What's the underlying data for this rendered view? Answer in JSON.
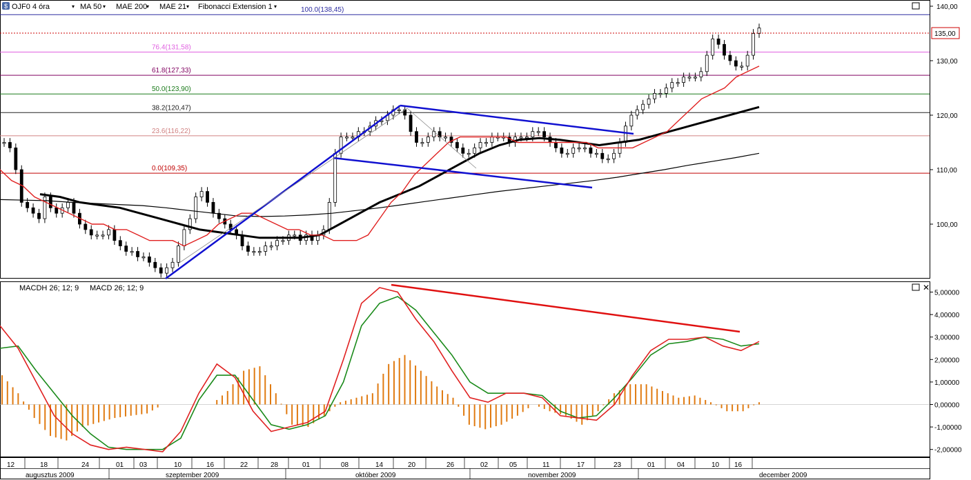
{
  "toolbar": {
    "symbol": "OJF0 4 óra",
    "ma50": "MA 50",
    "mae200": "MAE 200",
    "mae21": "MAE 21",
    "fib": "Fibonacci Extension 1"
  },
  "macd_legend": {
    "macdh": "MACDH 26; 12; 9",
    "macd": "MACD 26; 12; 9"
  },
  "price_axis": {
    "ticks": [
      "140,00",
      "130,00",
      "120,00",
      "110,00",
      "100,00"
    ],
    "current": "135,00"
  },
  "macd_axis": {
    "ticks": [
      "5,00000",
      "4,00000",
      "3,00000",
      "2,00000",
      "1,00000",
      "0,00000",
      "-1,00000",
      "-2,00000"
    ]
  },
  "fib_levels": [
    {
      "label": "100.0(138,45)",
      "value": 138.45,
      "color": "#2a2aa0"
    },
    {
      "label": "76.4(131,58)",
      "value": 131.58,
      "color": "#e060e0"
    },
    {
      "label": "61.8(127,33)",
      "value": 127.33,
      "color": "#800060"
    },
    {
      "label": "50.0(123,90)",
      "value": 123.9,
      "color": "#1a7a1a"
    },
    {
      "label": "38.2(120,47)",
      "value": 120.47,
      "color": "#222222"
    },
    {
      "label": "23.6(116,22)",
      "value": 116.22,
      "color": "#d08080"
    },
    {
      "label": "0.0(109,35)",
      "value": 109.35,
      "color": "#c00000"
    }
  ],
  "x_axis": {
    "day_ticks": [
      "12",
      "18",
      "24",
      "01",
      "03",
      "10",
      "16",
      "22",
      "28",
      "01",
      "08",
      "14",
      "20",
      "26",
      "02",
      "05",
      "11",
      "17",
      "23",
      "01",
      "04",
      "10",
      "16"
    ],
    "month_labels": [
      "augusztus 2009",
      "szeptember 2009",
      "október 2009",
      "november 2009",
      "december 2009"
    ]
  },
  "colors": {
    "mae21": "#e02020",
    "mae200": "#000000",
    "ma50": "#000000",
    "macd": "#1a8a1a",
    "macdh": "#e07a10",
    "channel": "#1010d0",
    "divergence": "#e01010",
    "current": "#cc0000"
  },
  "chart_data": [
    {
      "type": "candlestick",
      "title": "OJF0 4 óra",
      "ylim": [
        91,
        141
      ],
      "current_price": 135.0,
      "series_close": [
        115,
        114,
        110,
        104,
        103,
        102,
        101,
        105,
        103,
        102,
        103,
        104,
        102,
        100,
        99,
        98,
        98,
        98,
        99,
        97,
        96,
        95,
        95,
        94,
        94,
        93,
        92,
        91,
        92,
        93,
        96,
        99,
        101,
        105,
        106,
        104,
        102,
        101,
        100,
        99,
        98,
        96,
        95,
        95,
        95,
        96,
        96,
        97,
        97,
        98,
        98,
        97,
        98,
        97,
        98,
        99,
        104,
        113,
        116,
        116,
        116,
        117,
        117,
        118,
        119,
        119,
        120,
        121,
        121,
        120,
        117,
        115,
        115,
        116,
        117,
        116,
        116,
        115,
        114,
        113,
        113,
        114,
        115,
        115,
        116,
        116,
        116,
        115,
        116,
        116,
        116,
        117,
        117,
        116,
        115,
        114,
        113,
        113,
        114,
        114,
        114,
        113,
        113,
        112,
        112,
        113,
        115,
        118,
        120,
        121,
        122,
        123,
        124,
        124,
        125,
        126,
        126,
        127,
        127,
        127,
        128,
        131,
        134,
        133,
        131,
        130,
        129,
        129,
        131,
        135,
        136
      ],
      "mae21": [
        110,
        108,
        107,
        105,
        104,
        103,
        102,
        101,
        100,
        100,
        99,
        99,
        98,
        97,
        97,
        97,
        96,
        97,
        98,
        100,
        101,
        102,
        102,
        101,
        100,
        99,
        99,
        98,
        98,
        97,
        97,
        97,
        98,
        101,
        104,
        106,
        109,
        111,
        113,
        115,
        116,
        116,
        116,
        116,
        116,
        115,
        115,
        115,
        115,
        115,
        115,
        115,
        114,
        114,
        114,
        114,
        115,
        116,
        117,
        119,
        121,
        123,
        124,
        125,
        127,
        128,
        129
      ],
      "mae200": [
        104.5,
        104.4,
        104.3,
        104.0,
        103.8,
        103.6,
        103.4,
        103.0,
        102.5,
        102.0,
        101.5,
        101.4,
        101.5,
        101.7,
        102.0,
        102.5,
        103.0,
        103.6,
        104.2,
        104.8,
        105.4,
        106.0,
        106.5,
        107.0,
        107.5,
        108.0,
        108.6,
        109.3,
        110.0,
        110.8,
        111.5,
        112.2,
        113.0
      ],
      "ma50": [
        105.5,
        105,
        104,
        103.5,
        103,
        102,
        101,
        100,
        99,
        98.5,
        98,
        97.5,
        97.5,
        97.5,
        98,
        100,
        102,
        104,
        105.5,
        107,
        109,
        111,
        113,
        114.5,
        115.5,
        115.8,
        115.5,
        115,
        114.5,
        115,
        115.5,
        116.5,
        117.5,
        118.5,
        119.5,
        120.5,
        121.5
      ]
    },
    {
      "type": "line",
      "title": "MACD 26; 12; 9",
      "ylim": [
        -2.3,
        5.3
      ],
      "macd": [
        3.5,
        2.5,
        1.0,
        -0.5,
        -1.3,
        -1.8,
        -2.0,
        -1.9,
        -2.0,
        -2.1,
        -1.2,
        0.5,
        1.8,
        1.2,
        -0.3,
        -1.2,
        -1.0,
        -0.8,
        -0.3,
        2.0,
        4.5,
        5.2,
        5.0,
        3.8,
        2.8,
        1.5,
        0.3,
        0.1,
        0.5,
        0.5,
        0.3,
        -0.5,
        -0.6,
        -0.7,
        0.0,
        1.3,
        2.4,
        2.9,
        2.9,
        3.0,
        2.6,
        2.4,
        2.8
      ],
      "signal": [
        2.5,
        2.6,
        1.5,
        0.5,
        -0.5,
        -1.3,
        -1.9,
        -2.0,
        -2.0,
        -2.0,
        -1.5,
        0.2,
        1.3,
        1.3,
        0.2,
        -0.9,
        -1.1,
        -0.9,
        -0.5,
        1.0,
        3.5,
        4.5,
        4.8,
        4.2,
        3.2,
        2.2,
        1.0,
        0.5,
        0.5,
        0.5,
        0.4,
        -0.3,
        -0.6,
        -0.5,
        0.3,
        1.2,
        2.2,
        2.7,
        2.8,
        3.0,
        2.9,
        2.6,
        2.7
      ],
      "histogram": [
        1.3,
        0.5,
        -0.6,
        -1.4,
        -1.6,
        -1.0,
        -0.8,
        -0.6,
        -0.5,
        -0.4,
        0.0,
        0.0,
        0.0,
        0.0,
        0.6,
        1.5,
        1.7,
        0.5,
        -0.9,
        -1.0,
        -0.5,
        0.1,
        0.3,
        0.5,
        1.8,
        2.2,
        1.5,
        0.8,
        0.3,
        -0.9,
        -1.1,
        -0.9,
        -0.5,
        0.0,
        -0.3,
        -0.5,
        -0.9,
        -0.3,
        0.5,
        0.9,
        0.9,
        0.6,
        0.3,
        0.4,
        0.1,
        -0.3,
        -0.3,
        0.1
      ]
    }
  ]
}
